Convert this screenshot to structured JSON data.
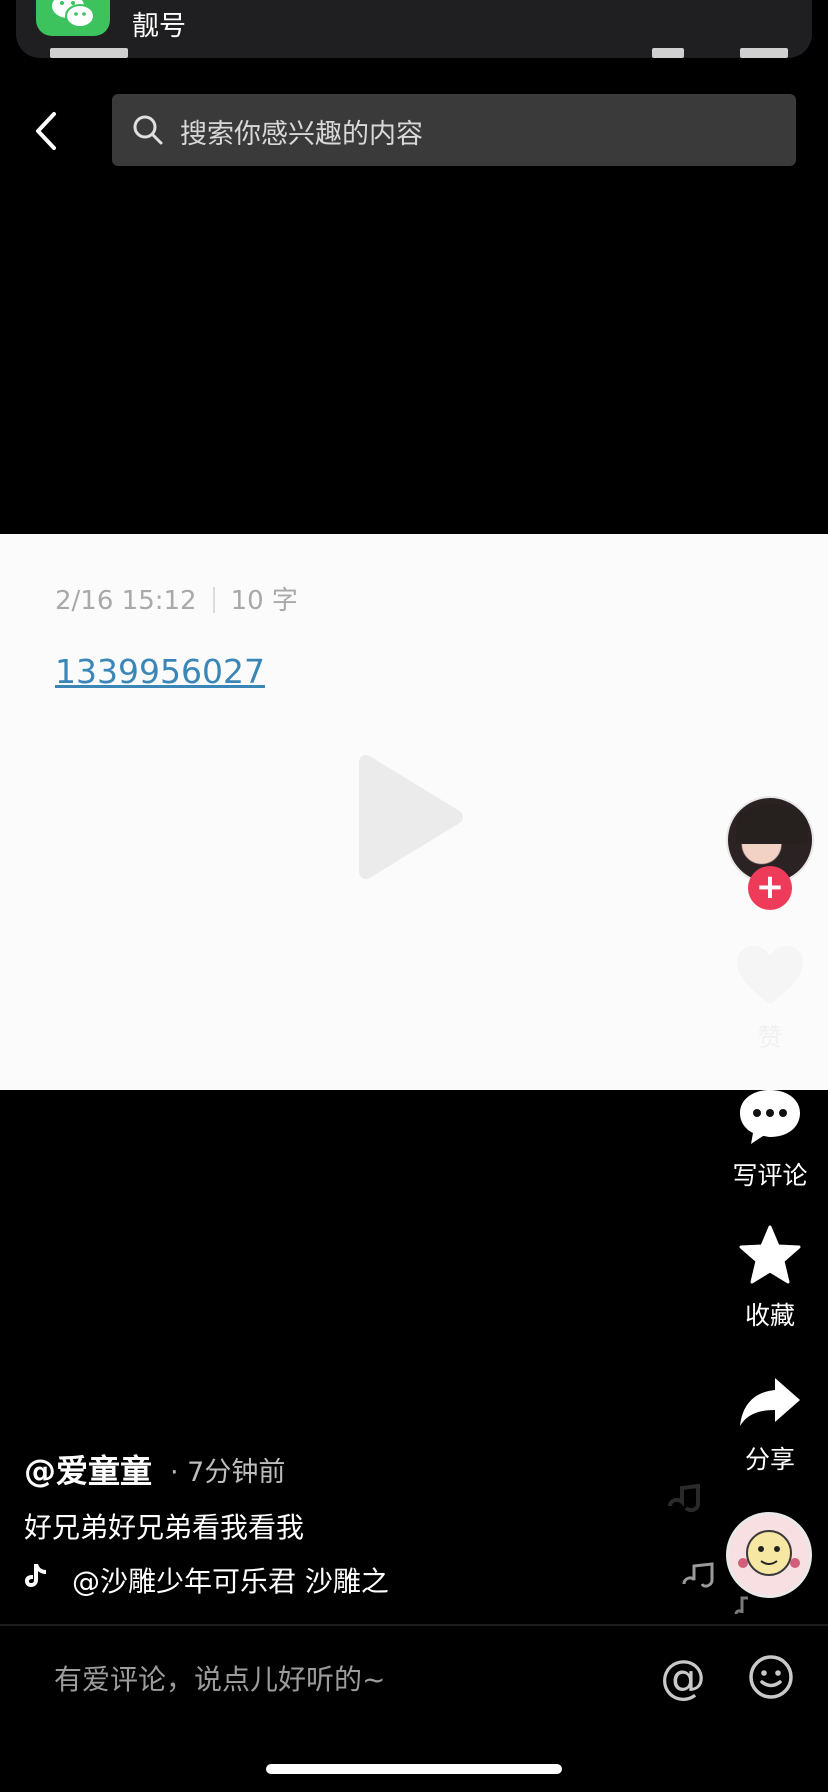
{
  "notification": {
    "app_icon": "wechat-icon",
    "text": "靓号"
  },
  "topbar": {
    "back_icon": "chevron-left-icon",
    "search_icon": "search-icon",
    "search_placeholder": "搜索你感兴趣的内容"
  },
  "card": {
    "date": "2/16 15:12",
    "char_count": "10 字",
    "phone_number": "1339956027"
  },
  "rail": {
    "follow_symbol": "+",
    "like_label": "赞",
    "comment_label": "写评论",
    "favorite_label": "收藏",
    "share_label": "分享"
  },
  "post": {
    "author": "@爱童童",
    "time": "· 7分钟前",
    "caption": "好兄弟好兄弟看我看我",
    "music": "@沙雕少年可乐君   沙雕之"
  },
  "comment_bar": {
    "placeholder": "有爱评论，说点儿好听的~",
    "at_label": "@",
    "emoji_icon": "smiley-icon"
  },
  "colors": {
    "follow_red": "#ee3b5a",
    "link_blue": "#3a86b6",
    "wechat_green": "#3cc35e"
  }
}
